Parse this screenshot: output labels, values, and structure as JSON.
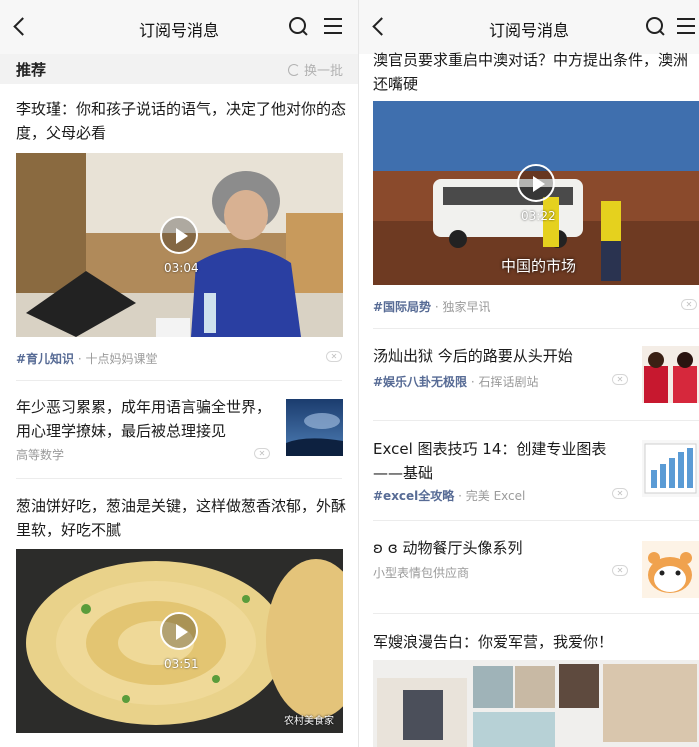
{
  "left": {
    "nav": {
      "title": "订阅号消息"
    },
    "recommend": {
      "title": "推荐",
      "refresh_label": "换一批"
    },
    "articles": [
      {
        "title": "李玫瑾：你和孩子说话的语气，决定了他对你的态度，父母必看",
        "duration": "03:04",
        "tag": "#育儿知识",
        "source": "十点妈妈课堂"
      },
      {
        "title": "年少恶习累累，成年用语言骗全世界，用心理学撩妹，最后被总理接见",
        "source": "高等数学"
      },
      {
        "title": "葱油饼好吃，葱油是关键，这样做葱香浓郁，外酥里软，好吃不腻",
        "duration": "03:51",
        "watermark": "农村美食家"
      }
    ]
  },
  "right": {
    "nav": {
      "title": "订阅号消息"
    },
    "articles": [
      {
        "title": "澳官员要求重启中澳对话？中方提出条件，澳洲还嘴硬",
        "duration": "03:22",
        "caption": "中国的市场",
        "tag": "#国际局势",
        "source": "独家早讯"
      },
      {
        "title": "汤灿出狱 今后的路要从头开始",
        "tag": "#娱乐八卦无极限",
        "source": "石挥话剧站"
      },
      {
        "title": "Excel 图表技巧 14：创建专业图表——基础",
        "tag": "#excel全攻略",
        "source": "完美 Excel"
      },
      {
        "title": "ʚ ɞ 动物餐厅头像系列",
        "source": "小型表情包供应商"
      },
      {
        "title": "军嫂浪漫告白：你爱军营，我爱你！"
      }
    ]
  },
  "colors": {
    "tag": "#576b95",
    "meta": "#9a9a9a",
    "nav_bg": "#f7f7f7",
    "section_bg": "#f2f2f2"
  },
  "icons": [
    "back-arrow-icon",
    "search-icon",
    "menu-icon",
    "refresh-icon",
    "play-icon",
    "close-icon"
  ]
}
